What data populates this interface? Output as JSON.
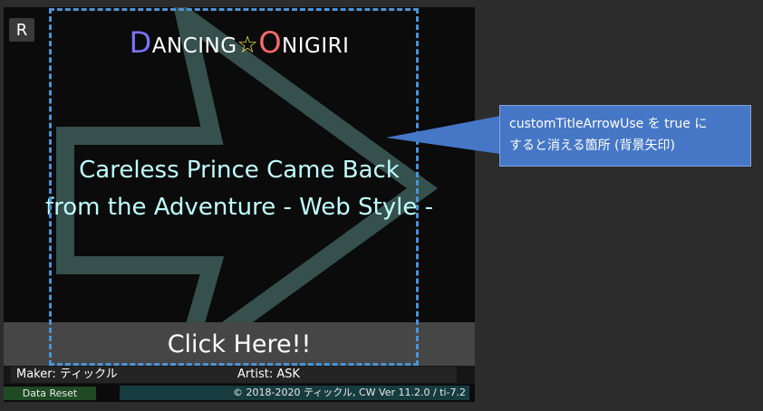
{
  "controls": {
    "reset_short": "R",
    "click_label": "Click Here!!",
    "data_reset": "Data Reset"
  },
  "logo": {
    "d": "D",
    "ancing": "ANCING",
    "star": "☆",
    "o": "O",
    "nigiri": "NIGIRI",
    "colors": {
      "d": "#7a73ff",
      "star": "#f2e44a",
      "o": "#ff6b6b",
      "rest": "#ffffff"
    }
  },
  "song": {
    "title_line1": "Careless Prince Came Back",
    "title_line2": "from the Adventure - Web Style -",
    "color": "#bfffff"
  },
  "credits": {
    "maker": "Maker: ティックル",
    "artist": "Artist: ASK",
    "copyright": "© 2018-2020 ティックル, CW Ver 11.2.0 / ti-7.2"
  },
  "annotation": {
    "line1": "customTitleArrowUse を true に",
    "line2": "すると消える箇所 (背景矢印)",
    "border_color": "#4a93d6",
    "callout_color": "#4677c7"
  },
  "icons": {
    "background_arrow": "right-arrow-outline-icon"
  }
}
